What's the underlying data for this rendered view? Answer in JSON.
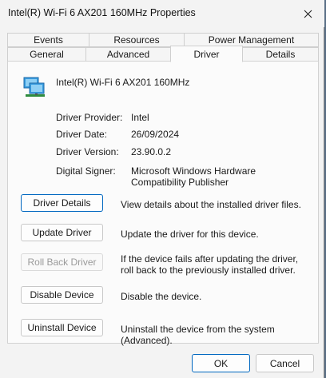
{
  "window": {
    "title": "Intel(R) Wi-Fi 6 AX201 160MHz Properties"
  },
  "tabs": {
    "row1": [
      {
        "label": "Events"
      },
      {
        "label": "Resources"
      },
      {
        "label": "Power Management"
      }
    ],
    "row2": [
      {
        "label": "General"
      },
      {
        "label": "Advanced"
      },
      {
        "label": "Driver",
        "active": true
      },
      {
        "label": "Details"
      }
    ]
  },
  "device": {
    "icon": "network-adapter-icon",
    "name": "Intel(R) Wi-Fi 6 AX201 160MHz"
  },
  "info": {
    "provider_label": "Driver Provider:",
    "provider_value": "Intel",
    "date_label": "Driver Date:",
    "date_value": "26/09/2024",
    "version_label": "Driver Version:",
    "version_value": "23.90.0.2",
    "signer_label": "Digital Signer:",
    "signer_value": "Microsoft Windows Hardware Compatibility Publisher"
  },
  "actions": {
    "details": {
      "label": "Driver Details",
      "desc": "View details about the installed driver files."
    },
    "update": {
      "label": "Update Driver",
      "desc": "Update the driver for this device."
    },
    "rollback": {
      "label": "Roll Back Driver",
      "desc": "If the device fails after updating the driver, roll back to the previously installed driver.",
      "enabled": false
    },
    "disable": {
      "label": "Disable Device",
      "desc": "Disable the device."
    },
    "uninstall": {
      "label": "Uninstall Device",
      "desc": "Uninstall the device from the system (Advanced)."
    }
  },
  "footer": {
    "ok_label": "OK",
    "cancel_label": "Cancel"
  },
  "colors": {
    "accent": "#0067c0",
    "window_bg": "#f3f3f3",
    "panel_bg": "#fbfbfb"
  }
}
